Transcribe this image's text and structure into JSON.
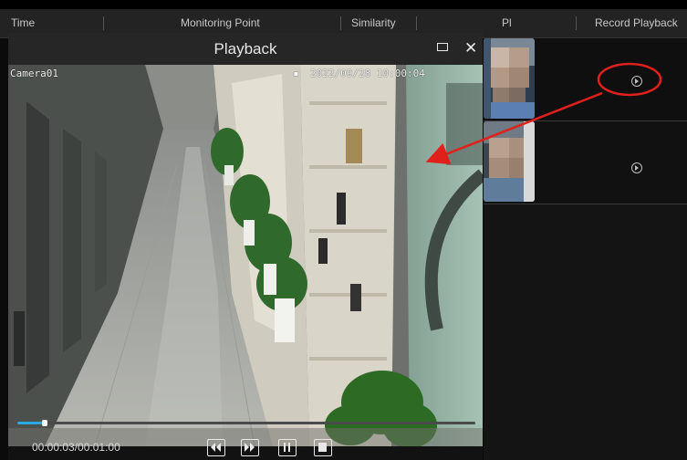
{
  "header": {
    "columns": [
      {
        "label": "Time"
      },
      {
        "label": "Monitoring Point"
      },
      {
        "label": "Similarity"
      },
      {
        "label": "Pl"
      },
      {
        "label": "Record Playback"
      }
    ]
  },
  "playback": {
    "title": "Playback",
    "osd_camera": "Camera01",
    "osd_timestamp": "2022/09/28 10:00:04",
    "time_display": "00:00:03/00:01:00",
    "progress": 0.06
  },
  "icons": {
    "maximize": "maximize-icon",
    "close": "close-icon",
    "rewind": "rewind-icon",
    "fast_forward": "fast-forward-icon",
    "pause": "pause-icon",
    "stop": "stop-icon",
    "play": "play-circle-icon"
  },
  "colors": {
    "progress": "#29a9e0",
    "annotation": "#e0201b"
  }
}
